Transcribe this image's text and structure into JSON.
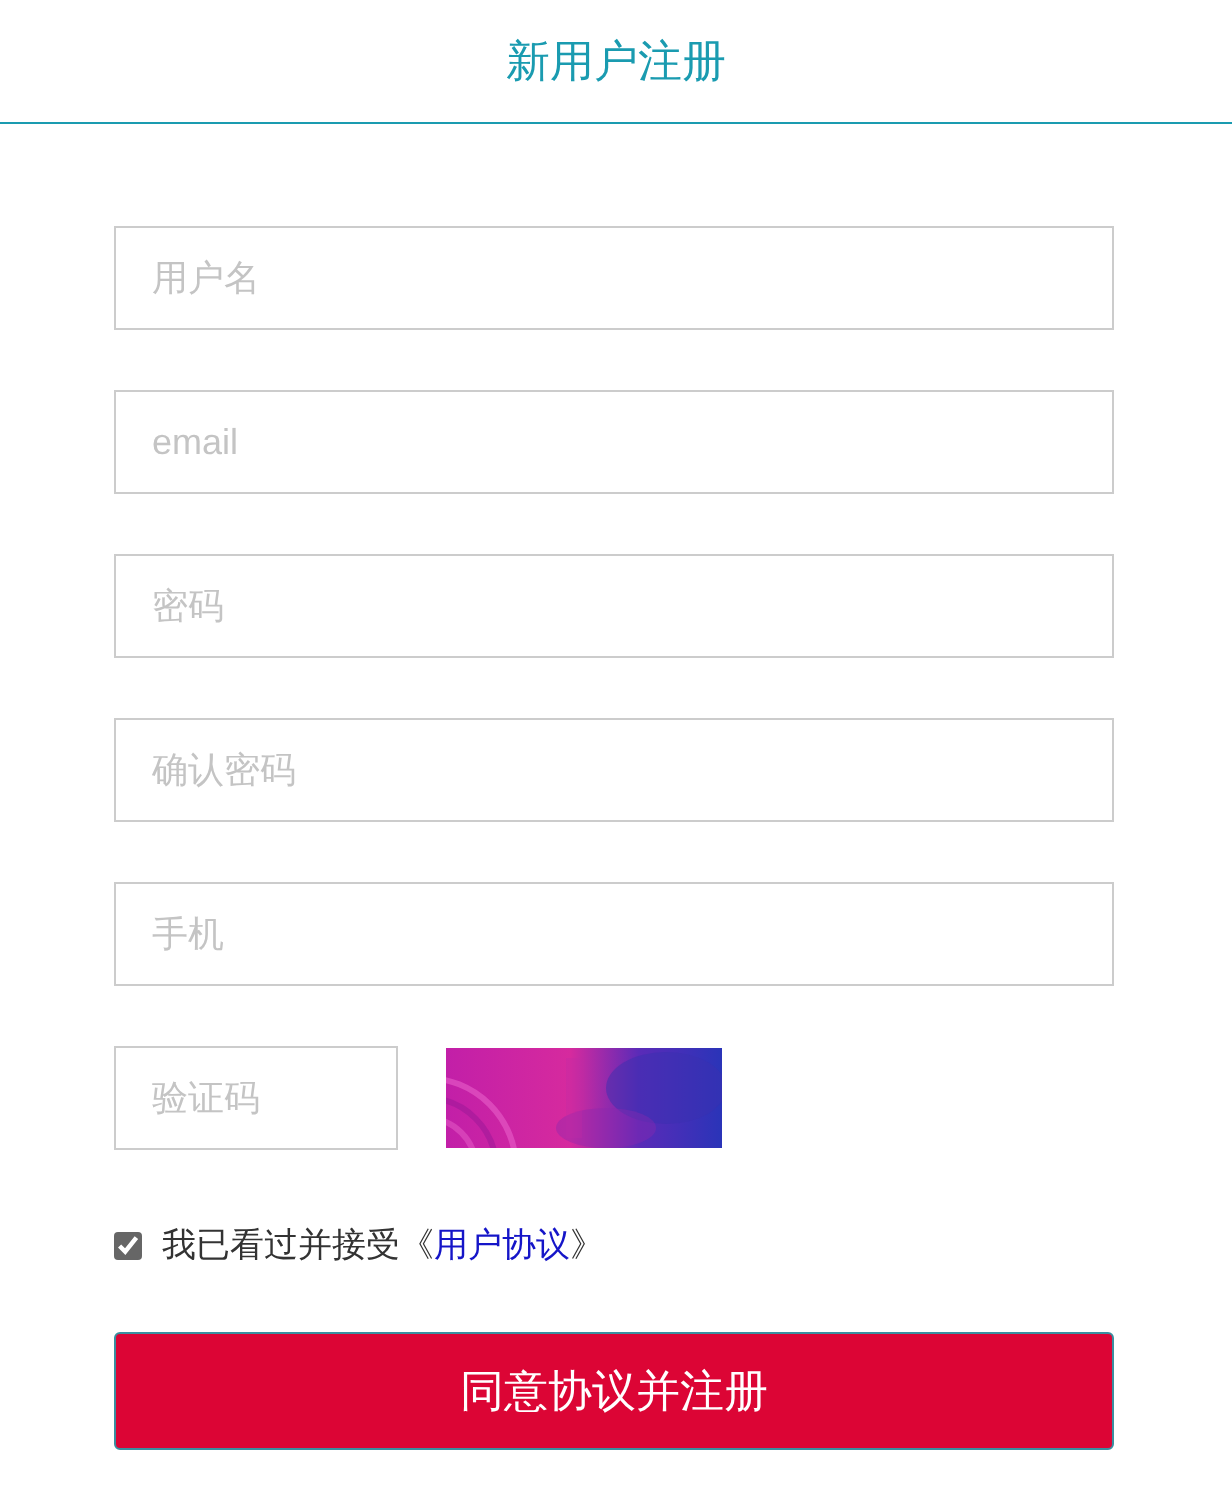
{
  "header": {
    "title": "新用户注册"
  },
  "fields": [
    {
      "placeholder": "用户名"
    },
    {
      "placeholder": "email"
    },
    {
      "placeholder": "密码"
    },
    {
      "placeholder": "确认密码"
    },
    {
      "placeholder": "手机"
    }
  ],
  "captcha": {
    "placeholder": "验证码"
  },
  "agreement": {
    "checked": true,
    "text_before": "我已看过并接受《",
    "link": "用户协议",
    "text_after": "》"
  },
  "submit": {
    "label": "同意协议并注册"
  }
}
